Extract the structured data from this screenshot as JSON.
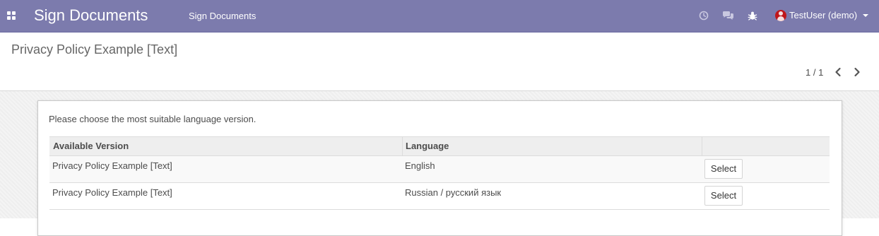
{
  "navbar": {
    "app_title": "Sign Documents",
    "menu_item": "Sign Documents",
    "user_name": "TestUser (demo)",
    "icons": [
      "apps-icon",
      "clock-icon",
      "chat-icon",
      "bug-icon",
      "avatar",
      "caret-down-icon"
    ],
    "background": "#7c7bad"
  },
  "control_panel": {
    "title": "Privacy Policy Example [Text]",
    "pager": "1 / 1"
  },
  "content": {
    "instruction": "Please choose the most suitable language version.",
    "columns": [
      "Available Version",
      "Language",
      ""
    ],
    "rows": [
      {
        "version": "Privacy Policy Example [Text]",
        "language": "English",
        "action": "Select"
      },
      {
        "version": "Privacy Policy Example [Text]",
        "language": "Russian / русский язык",
        "action": "Select"
      }
    ]
  }
}
